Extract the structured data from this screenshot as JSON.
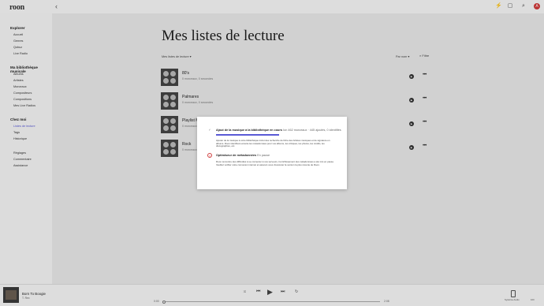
{
  "app": {
    "logo": "roon",
    "back_icon": "‹",
    "avatar_letter": "A",
    "accent_color": "#5a5ad6"
  },
  "topbar": {
    "icons": [
      "flash-icon",
      "bookmark-icon",
      "search-icon",
      "bell-icon"
    ]
  },
  "sidebar": {
    "sections": [
      {
        "heading": "Explorer",
        "items": [
          "Accueil",
          "Genres",
          "Qobuz",
          "Live Radio"
        ]
      },
      {
        "heading": "Ma bibliothèque musicale",
        "items": [
          "Albums",
          "Artistes",
          "Morceaux",
          "Compositeurs",
          "Compositions",
          "Mes Live Radios"
        ]
      },
      {
        "heading": "Chez moi",
        "items": [
          "Listes de lecture",
          "Tags",
          "Historique"
        ]
      },
      {
        "heading": "",
        "items": [
          "Réglages",
          "Commentaire",
          "Assistance"
        ]
      }
    ],
    "active_item": "Listes de lecture"
  },
  "main": {
    "title": "Mes listes de lecture",
    "filter_dropdown": "Mes listes de lecture ▾",
    "sort_dropdown": "Par nom ▾",
    "filter_button": "Filtre",
    "playlists": [
      {
        "title": "80's",
        "subtitle": "0 morceaux, 0 secondes"
      },
      {
        "title": "Palmares",
        "subtitle": "0 morceaux, 0 secondes"
      },
      {
        "title": "Playlist M",
        "subtitle": "0 morceaux"
      },
      {
        "title": "Rock",
        "subtitle": "0 morceaux"
      }
    ]
  },
  "modal": {
    "section1": {
      "title": "Ajout de la musique à la bibliothèque en cours",
      "detail": "Ion 462 morceaux · 445 ajoutés, 0 identifiés",
      "description": "Ajouter de la musique à votre bibliothèque inclut des recherche de fiche des Artistes musiques et de signature en albums. Roon identifiera ensuite les métadonnées pour vos albums, les critiques, les photos, les crédits, les discographies, etc."
    },
    "section2": {
      "title": "Optimiseur de métadonnées",
      "detail": "En pause",
      "description": "Roon rencontre des difficultés à se connecter à nos serveurs, l'enrichissement des métadonnées a été mis en pause. Veuillez vérifier votre connexion internet et assurez-vous d'exécuter la version la plus récente de Roon."
    }
  },
  "player": {
    "track_title": "Born To Boogie",
    "artist": "T. Rex",
    "time_elapsed": "0:00",
    "time_total": "2:08",
    "zone_label": "Système Audio",
    "volume_label": "100",
    "controls": [
      "shuffle-icon",
      "previous-icon",
      "play-icon",
      "next-icon",
      "repeat-icon"
    ]
  }
}
